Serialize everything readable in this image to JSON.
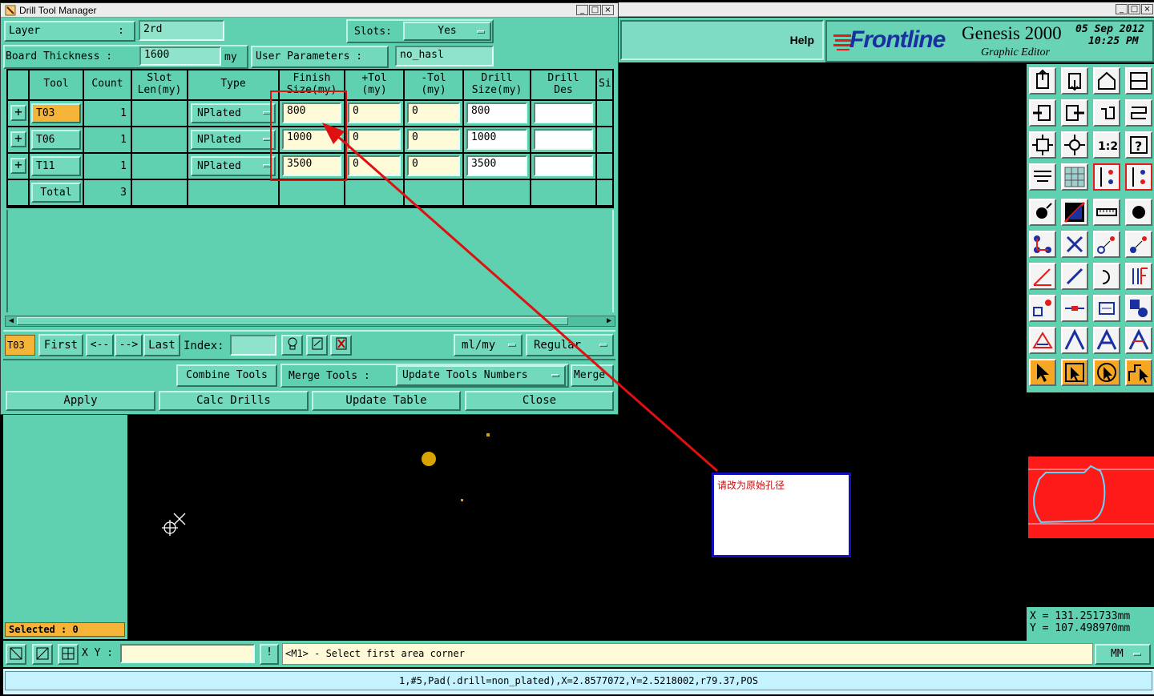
{
  "dialog": {
    "title": "Drill Tool Manager",
    "layer_label": "Layer",
    "layer_colon": ":",
    "layer_value": "2rd",
    "slots_label": "Slots:",
    "slots_value": "Yes",
    "board_thickness_label": "Board Thickness :",
    "board_thickness_value": "1600",
    "board_thickness_unit": "my",
    "user_params_label": "User Parameters :",
    "user_params_value": "no_hasl",
    "columns": [
      "Tool",
      "Count",
      "Slot\nLen(my)",
      "Type",
      "Finish\nSize(my)",
      "+Tol\n(my)",
      "-Tol\n(my)",
      "Drill\nSize(my)",
      "Drill\nDes",
      "Si"
    ],
    "rows": [
      {
        "tool": "T03",
        "count": "1",
        "type": "NPlated",
        "finish": "800",
        "ptol": "0",
        "ntol": "0",
        "drill": "800",
        "des": ""
      },
      {
        "tool": "T06",
        "count": "1",
        "type": "NPlated",
        "finish": "1000",
        "ptol": "0",
        "ntol": "0",
        "drill": "1000",
        "des": ""
      },
      {
        "tool": "T11",
        "count": "1",
        "type": "NPlated",
        "finish": "3500",
        "ptol": "0",
        "ntol": "0",
        "drill": "3500",
        "des": ""
      }
    ],
    "total_label": "Total",
    "total_count": "3",
    "nav": {
      "current": "T03",
      "first": "First",
      "prev": "<--",
      "next": "-->",
      "last": "Last",
      "index_label": "Index:",
      "units": "ml/my",
      "mode": "Regular"
    },
    "actions": {
      "combine": "Combine Tools",
      "merge": "Merge Tools :",
      "update_numbers": "Update Tools Numbers",
      "merge2": "Merge",
      "apply": "Apply",
      "calc": "Calc Drills",
      "update_table": "Update Table",
      "close": "Close"
    }
  },
  "app": {
    "help": "Help",
    "brand": "Frontline",
    "product": "Genesis 2000",
    "subtitle": "Graphic Editor",
    "date": "05 Sep 2012",
    "time": "10:25 PM",
    "selected": "Selected : 0",
    "xy_label": "X Y :",
    "xy_value": "",
    "prompt": "<M1> - Select first area corner",
    "units": "MM",
    "coord_x": "X  =  131.251733mm",
    "coord_y": "Y  =  107.498970mm",
    "status_line": "1,#5,Pad(.drill=non_plated),X=2.8577072,Y=2.5218002,r79.37,POS"
  },
  "annotation": {
    "note": "请改为原始孔径",
    "arrow_color": "#e01010",
    "box_border": "#1010c0"
  },
  "colors": {
    "panel": "#5fd0b0",
    "field": "#fffbd8",
    "tool_highlight": "#f5b338",
    "drawing_pad": "#d8a200",
    "preview_bg": "#ff1a1a"
  }
}
